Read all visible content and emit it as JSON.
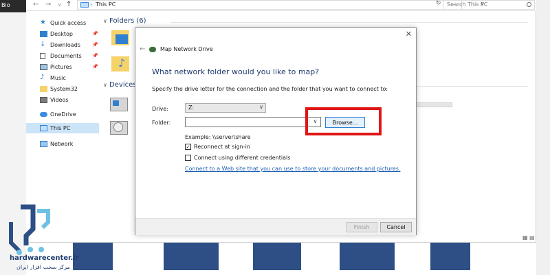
{
  "background": {
    "top_left_text": "Bio"
  },
  "explorer": {
    "address": "This PC",
    "search_placeholder": "Search This PC",
    "sidebar": {
      "items": [
        {
          "label": "Quick access",
          "pinned": false
        },
        {
          "label": "Desktop",
          "pinned": true
        },
        {
          "label": "Downloads",
          "pinned": true
        },
        {
          "label": "Documents",
          "pinned": true
        },
        {
          "label": "Pictures",
          "pinned": true
        },
        {
          "label": "Music",
          "pinned": false
        },
        {
          "label": "System32",
          "pinned": false
        },
        {
          "label": "Videos",
          "pinned": false
        },
        {
          "label": "OneDrive",
          "pinned": false
        },
        {
          "label": "This PC",
          "pinned": false
        },
        {
          "label": "Network",
          "pinned": false
        }
      ]
    },
    "groups": {
      "folders": "Folders (6)",
      "devices": "Devices"
    }
  },
  "dialog": {
    "title": "Map Network Drive",
    "heading": "What network folder would you like to map?",
    "description": "Specify the drive letter for the connection and the folder that you want to connect to:",
    "drive_label": "Drive:",
    "drive_value": "Z:",
    "folder_label": "Folder:",
    "folder_value": "",
    "browse_label": "Browse...",
    "example": "Example: \\\\server\\share",
    "reconnect_label": "Reconnect at sign-in",
    "reconnect_checked": true,
    "credentials_label": "Connect using different credentials",
    "credentials_checked": false,
    "link": "Connect to a Web site that you can use to store your documents and pictures.",
    "finish_label": "Finish",
    "cancel_label": "Cancel"
  },
  "logo": {
    "name": "hardwarecenter.ir",
    "tagline": "مرکز سخت افزار ایران"
  },
  "colors": {
    "accent_blue": "#2f80d1",
    "highlight_red": "#e01515",
    "heading_blue": "#1e3a6e",
    "link_blue": "#1a5fb4"
  }
}
